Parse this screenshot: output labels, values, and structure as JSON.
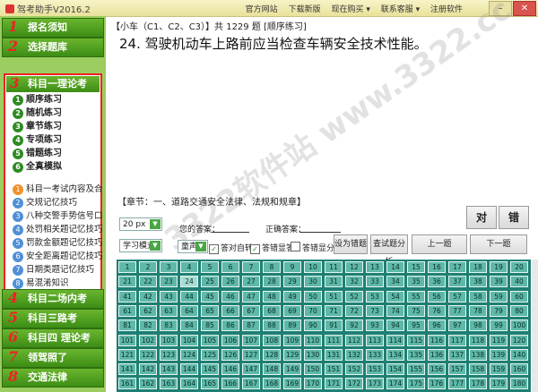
{
  "window": {
    "title": "驾考助手V2016.2",
    "menu": [
      "官方网站",
      "下载新版",
      "现在购买 ▾",
      "联系客服 ▾",
      "注册软件"
    ]
  },
  "sidebar": {
    "top_items": [
      {
        "num": "1",
        "label": "报名须知"
      },
      {
        "num": "2",
        "label": "选择题库"
      }
    ],
    "subject": {
      "num": "3",
      "label": "科目一理论考"
    },
    "practice": [
      {
        "num": "1",
        "label": "顺序练习"
      },
      {
        "num": "2",
        "label": "随机练习"
      },
      {
        "num": "3",
        "label": "章节练习"
      },
      {
        "num": "4",
        "label": "专项练习"
      },
      {
        "num": "5",
        "label": "错题练习"
      },
      {
        "num": "6",
        "label": "全真模拟"
      }
    ],
    "tips": [
      {
        "num": "1",
        "label": "科目一考试内容及合",
        "color": "#f0912c"
      },
      {
        "num": "2",
        "label": "交规记忆技巧",
        "color": "#4f8fd8"
      },
      {
        "num": "3",
        "label": "八种交警手势信号口",
        "color": "#4f8fd8"
      },
      {
        "num": "4",
        "label": "处罚相关题记忆技巧",
        "color": "#4f8fd8"
      },
      {
        "num": "5",
        "label": "罚款金额题记忆技巧",
        "color": "#4f8fd8"
      },
      {
        "num": "6",
        "label": "安全距离题记忆技巧",
        "color": "#4f8fd8"
      },
      {
        "num": "7",
        "label": "日期类题记忆技巧",
        "color": "#4f8fd8"
      },
      {
        "num": "8",
        "label": "易混淆知识",
        "color": "#4f8fd8"
      }
    ],
    "bottom_items": [
      {
        "num": "4",
        "label": "科目二场内考"
      },
      {
        "num": "5",
        "label": "科目三路考"
      },
      {
        "num": "6",
        "label": "科目四 理论考"
      },
      {
        "num": "7",
        "label": "领驾照了"
      },
      {
        "num": "8",
        "label": "交通法律"
      }
    ]
  },
  "main": {
    "crumb": "【小车（C1、C2、C3）】共 1229 题 [顺序练习]",
    "question": "24. 驾驶机动车上路前应当检查车辆安全技术性能。",
    "watermark": "3322软件站  www.3322.cc",
    "chapter": "【章节：一、道路交通安全法律、法规和规章】",
    "font_size": "20 px",
    "mode": "学习模式",
    "sound": "童声",
    "your_answer_label": "您的答案：",
    "correct_answer_label": "正确答案：",
    "answer_true": "对",
    "answer_false": "错",
    "check_auto_next": "答对自转",
    "check_show_wrong": "答错显答",
    "check_show_score": "答错显分",
    "btn_mark_wrong": "设为错题",
    "btn_analysis": "查试题分析",
    "btn_prev": "上一题",
    "btn_next": "下一题",
    "current_question": 24,
    "grid_first": 1,
    "grid_last": 180,
    "grid_cols": 20
  }
}
